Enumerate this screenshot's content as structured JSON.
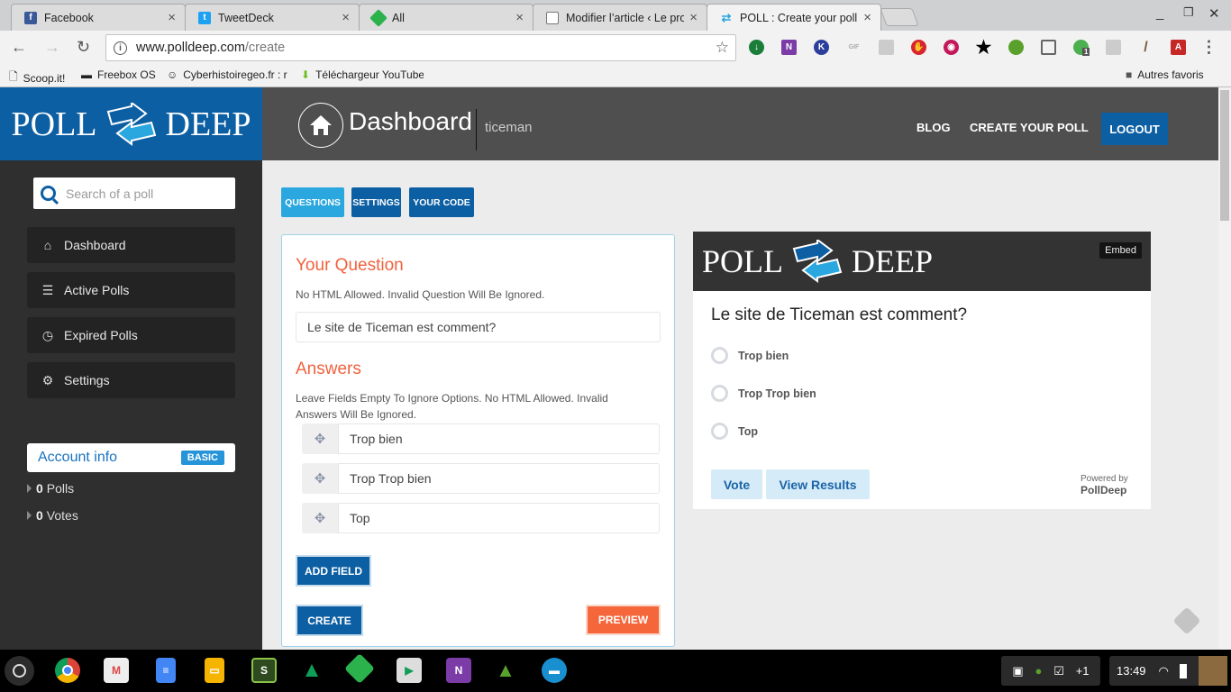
{
  "browser": {
    "tabs": [
      {
        "title": "Facebook",
        "icon": "facebook-icon",
        "color": "#3b5998",
        "glyph": "f"
      },
      {
        "title": "TweetDeck",
        "icon": "tweetdeck-icon",
        "color": "#1da1f2",
        "glyph": "t"
      },
      {
        "title": "All",
        "icon": "feedly-icon",
        "color": "#2bb24c",
        "glyph": "f"
      },
      {
        "title": "Modifier l’article ‹ Le pro",
        "icon": "page-icon",
        "color": "#ffffff",
        "glyph": ""
      },
      {
        "title": "POLL : Create your poll f",
        "icon": "polldeep-icon",
        "color": "#2aa7df",
        "glyph": "⇄",
        "active": true
      }
    ],
    "url_host": "www.polldeep.com",
    "url_path": "/create",
    "bookmarks": [
      {
        "label": "Scoop.it!",
        "icon": "page-icon"
      },
      {
        "label": "Freebox OS",
        "icon": "freebox-icon"
      },
      {
        "label": "Cyberhistoiregeo.fr : r",
        "icon": "cyberhistoire-icon"
      },
      {
        "label": "Téléchargeur YouTube",
        "icon": "download-icon"
      }
    ],
    "other_bookmarks": "Autres favoris",
    "extensions_badge": "1"
  },
  "header": {
    "logo_word1": "Poll",
    "logo_word2": "Deep",
    "title": "Dashboard",
    "username": "ticeman",
    "nav": [
      "BLOG",
      "CREATE YOUR POLL"
    ],
    "logout": "LOGOUT"
  },
  "sidebar": {
    "search_placeholder": "Search of a poll",
    "items": [
      {
        "label": "Dashboard",
        "icon": "home-icon"
      },
      {
        "label": "Active Polls",
        "icon": "list-icon"
      },
      {
        "label": "Expired Polls",
        "icon": "clock-icon"
      },
      {
        "label": "Settings",
        "icon": "gear-icon"
      }
    ],
    "account_title": "Account info",
    "account_badge": "BASIC",
    "stats": [
      {
        "count": "0",
        "label": "Polls"
      },
      {
        "count": "0",
        "label": "Votes"
      }
    ]
  },
  "content": {
    "tabs": [
      "QUESTIONS",
      "SETTINGS",
      "YOUR CODE"
    ],
    "form": {
      "question_title": "Your Question",
      "question_note": "No HTML Allowed. Invalid Question Will Be Ignored.",
      "question_value": "Le site de Ticeman est comment?",
      "answers_title": "Answers",
      "answers_note": "Leave Fields Empty To Ignore Options. No HTML Allowed. Invalid Answers Will Be Ignored.",
      "answers": [
        "Trop bien",
        "Trop Trop bien",
        "Top"
      ],
      "add_field": "ADD FIELD",
      "create": "CREATE",
      "preview": "PREVIEW"
    },
    "widget": {
      "embed": "Embed",
      "question": "Le site de Ticeman est comment?",
      "options": [
        "Trop bien",
        "Trop Trop bien",
        "Top"
      ],
      "vote": "Vote",
      "view_results": "View Results",
      "powered_by": "Powered by",
      "powered_brand": "PollDeep"
    }
  },
  "shelf": {
    "apps": [
      "chrome",
      "gmail",
      "docs",
      "slides",
      "app-green",
      "drive",
      "feedly",
      "play-store",
      "onenote",
      "turtle",
      "files"
    ],
    "tray_more": "+1",
    "time": "13:49"
  },
  "colors": {
    "brand_blue": "#0d5fa3",
    "light_blue": "#2aa7df",
    "accent_orange": "#f0623e",
    "topbar": "#4f4f4f",
    "sidebar": "#2f2f2f"
  }
}
